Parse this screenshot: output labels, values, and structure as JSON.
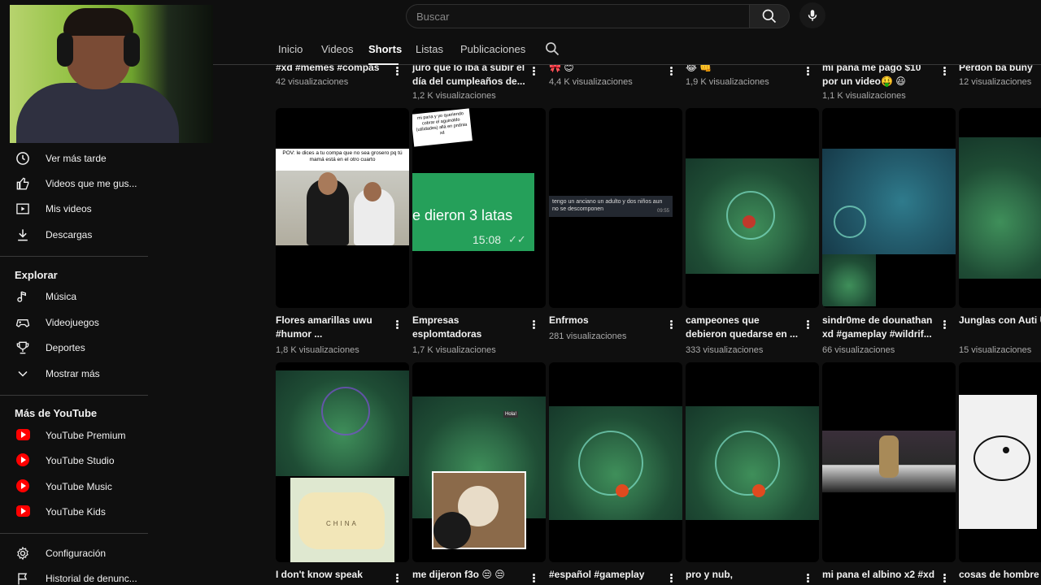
{
  "search": {
    "placeholder": "Buscar"
  },
  "tabs": [
    "Inicio",
    "Videos",
    "Shorts",
    "Listas",
    "Publicaciones"
  ],
  "sidebar": {
    "items": [
      {
        "label": "Ver más tarde",
        "icon": "clock-icon"
      },
      {
        "label": "Videos que me gus...",
        "icon": "thumbs-up-icon"
      },
      {
        "label": "Mis videos",
        "icon": "play-square-icon"
      },
      {
        "label": "Descargas",
        "icon": "download-icon"
      }
    ],
    "explore_heading": "Explorar",
    "explore": [
      {
        "label": "Música",
        "icon": "music-note-icon"
      },
      {
        "label": "Videojuegos",
        "icon": "gamepad-icon"
      },
      {
        "label": "Deportes",
        "icon": "trophy-icon"
      },
      {
        "label": "Mostrar más",
        "icon": "chevron-down-icon"
      }
    ],
    "more_heading": "Más de YouTube",
    "more": [
      {
        "label": "YouTube Premium",
        "icon": "youtube-premium-icon"
      },
      {
        "label": "YouTube Studio",
        "icon": "youtube-studio-icon"
      },
      {
        "label": "YouTube Music",
        "icon": "youtube-music-icon"
      },
      {
        "label": "YouTube Kids",
        "icon": "youtube-kids-icon"
      }
    ],
    "settings": [
      {
        "label": "Configuración",
        "icon": "gear-icon"
      },
      {
        "label": "Historial de denunc...",
        "icon": "flag-icon"
      }
    ]
  },
  "row0": [
    {
      "title": "#xd #memes #compas",
      "views": "42 visualizaciones"
    },
    {
      "title": "juro que lo iba a subir el día del cumpleaños de...",
      "views": "1,2 K visualizaciones"
    },
    {
      "title": "🎀 😊",
      "views": "4,4 K visualizaciones"
    },
    {
      "title": "😂 👊",
      "views": "1,9 K visualizaciones"
    },
    {
      "title": "mi pana me pagó $10 por un video🤑 😃",
      "views": "1,1 K visualizaciones"
    },
    {
      "title": "Perdón ba buny",
      "views": "12 visualizaciones"
    }
  ],
  "row1": [
    {
      "title": "Flores amarillas uwu #humor ...",
      "views": "1,8 K visualizaciones",
      "overlay": "POV: le dices a tu compa que no sea grosero pq tú mamá está en el otro cuarto"
    },
    {
      "title": "Empresas esplomtadoras",
      "views": "1,7 K visualizaciones",
      "overlay": "mi pana y yo queriendo cobrar el aguinaldo (utilidades) allá en pndnia xd",
      "chat_text": "e dieron 3 latas",
      "chat_time": "15:08"
    },
    {
      "title": "Enfrmos",
      "views": "281 visualizaciones",
      "overlay": "tengo un anciano un adulto y dos niños aun no se descomponen",
      "overlay_time": "09:55"
    },
    {
      "title": "campeones que debieron quedarse en ...",
      "views": "333 visualizaciones"
    },
    {
      "title": "sindr0me de dounathan xd #gameplay #wildrif...",
      "views": "66 visualizaciones"
    },
    {
      "title": "Junglas con Auti UnU",
      "views": "15 visualizaciones"
    }
  ],
  "row2": [
    {
      "title": "I don't know speak",
      "map_label": "CHINA"
    },
    {
      "title": "me dijeron f3o 😒 😒",
      "overlay": "Hola!"
    },
    {
      "title": "#español #gameplay"
    },
    {
      "title": "pro y nub,"
    },
    {
      "title": "mi pana el albino x2 #xd"
    },
    {
      "title": "cosas de hombre"
    }
  ],
  "colors": {
    "background": "#0f0f0f",
    "youtube_red": "#ff0000",
    "whatsapp_green": "#25a05a"
  }
}
